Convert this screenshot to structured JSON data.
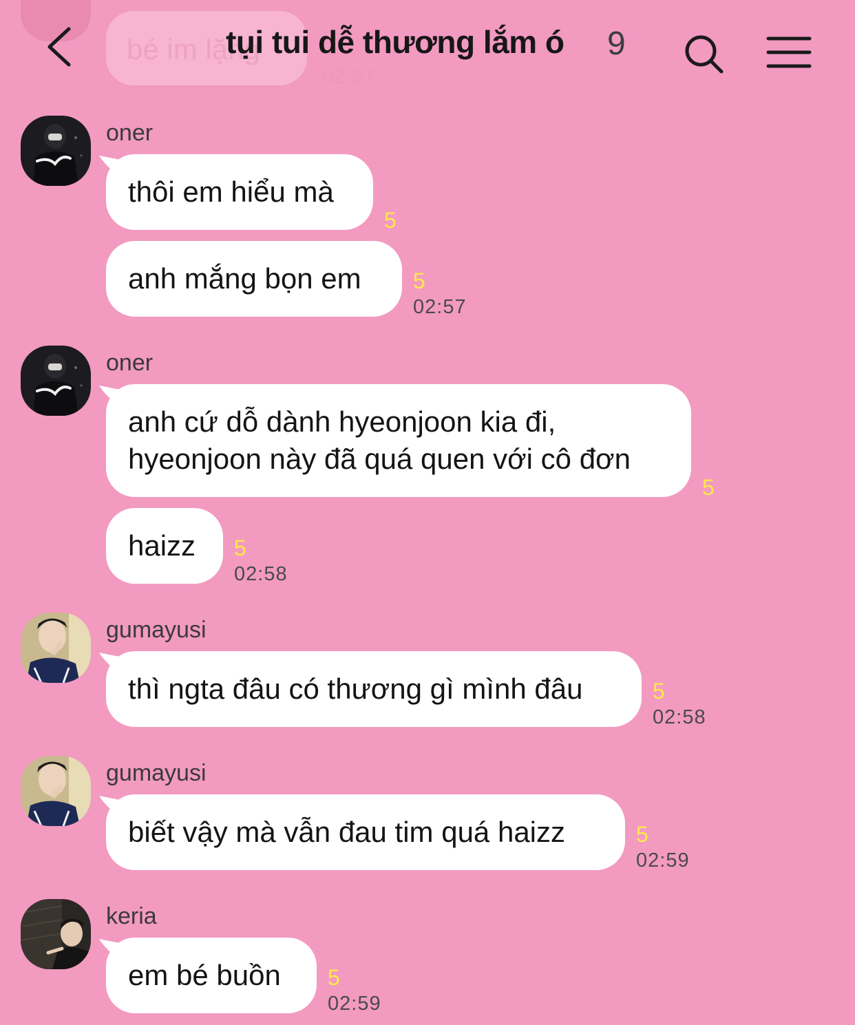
{
  "app": {
    "accent_background": "#f39ac1",
    "bubble_color": "#ffffff",
    "unread_color": "#ffe94a"
  },
  "header": {
    "title": "tụi tui dễ thương lắm ó",
    "member_count": "9",
    "back_icon": "chevron-left-icon",
    "search_icon": "search-icon",
    "menu_icon": "hamburger-menu-icon"
  },
  "faded_message": {
    "text": "bé im lặng",
    "time": "02:57"
  },
  "messages": [
    {
      "sender": "oner",
      "bubbles": [
        {
          "text": "thôi em hiểu mà",
          "unread": "5"
        },
        {
          "text": "anh mắng bọn em",
          "unread": "5",
          "time": "02:57"
        }
      ]
    },
    {
      "sender": "oner",
      "bubbles": [
        {
          "text": "anh cứ dỗ dành hyeonjoon kia đi,\nhyeonjoon này đã quá quen với cô đơn",
          "unread": "5"
        },
        {
          "text": "haizz",
          "unread": "5",
          "time": "02:58"
        }
      ]
    },
    {
      "sender": "gumayusi",
      "bubbles": [
        {
          "text": "thì ngta đâu có thương gì mình đâu",
          "unread": "5",
          "time": "02:58"
        }
      ]
    },
    {
      "sender": "gumayusi",
      "bubbles": [
        {
          "text": "biết vậy mà vẫn đau tim quá haizz",
          "unread": "5",
          "time": "02:59"
        }
      ]
    },
    {
      "sender": "keria",
      "bubbles": [
        {
          "text": "em bé buồn",
          "unread": "5",
          "time": "02:59"
        }
      ]
    }
  ]
}
